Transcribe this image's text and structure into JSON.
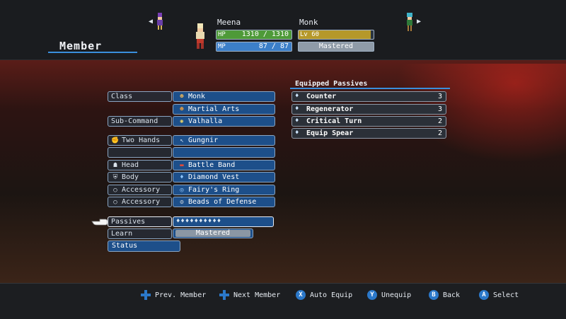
{
  "header": {
    "title": "Member",
    "member_name": "Meena",
    "class_name": "Monk",
    "hp_label": "HP",
    "hp_value": "1310 / 1310",
    "hp_fraction": 1.0,
    "mp_label": "MP",
    "mp_value": "87 /  87",
    "mp_fraction": 1.0,
    "level_label": "Lv",
    "level_value": "60",
    "level_fraction": 0.96,
    "mastery_text": "Mastered"
  },
  "equipment": [
    {
      "label": "Class",
      "label_icon": "",
      "value": "Monk",
      "value_icon": "monk-icon"
    },
    {
      "label": "",
      "label_icon": "",
      "value": "Martial Arts",
      "value_icon": "martial-arts-icon"
    },
    {
      "label": "Sub-Command",
      "label_icon": "",
      "value": "Valhalla",
      "value_icon": "valhalla-icon"
    },
    {
      "label": "Two Hands",
      "label_icon": "hand-icon",
      "value": "Gungnir",
      "value_icon": "spear-icon"
    },
    {
      "label": "",
      "label_icon": "",
      "value": "",
      "value_icon": ""
    },
    {
      "label": "Head",
      "label_icon": "helmet-icon",
      "value": "Battle Band",
      "value_icon": "headband-icon"
    },
    {
      "label": "Body",
      "label_icon": "armor-icon",
      "value": "Diamond Vest",
      "value_icon": "vest-icon"
    },
    {
      "label": "Accessory",
      "label_icon": "ring-slot-icon",
      "value": "Fairy's Ring",
      "value_icon": "ring-icon"
    },
    {
      "label": "Accessory",
      "label_icon": "ring-slot-icon",
      "value": "Beads of Defense",
      "value_icon": "beads-icon"
    }
  ],
  "passives": {
    "row_label": "Passives",
    "gem_count": 10,
    "gems_text": "♦♦♦♦♦♦♦♦♦♦",
    "learn_label": "Learn",
    "learn_value": "Mastered",
    "status_label": "Status",
    "equipped_title": "Equipped Passives",
    "equipped": [
      {
        "name": "Counter",
        "cost": "3"
      },
      {
        "name": "Regenerator",
        "cost": "3"
      },
      {
        "name": "Critical Turn",
        "cost": "2"
      },
      {
        "name": "Equip Spear",
        "cost": "2"
      }
    ]
  },
  "footer": {
    "hints": [
      {
        "button": "dpad-left",
        "label": "Prev. Member"
      },
      {
        "button": "dpad-right",
        "label": "Next Member"
      },
      {
        "button": "X",
        "label": "Auto Equip"
      },
      {
        "button": "Y",
        "label": "Unequip"
      },
      {
        "button": "B",
        "label": "Back"
      },
      {
        "button": "A",
        "label": "Select"
      }
    ]
  },
  "colors": {
    "accent": "#3a8fdc",
    "hp": "#4e9a38",
    "mp": "#3c7fc8",
    "level": "#b5982a",
    "slot_value": "#1d4f8a"
  }
}
